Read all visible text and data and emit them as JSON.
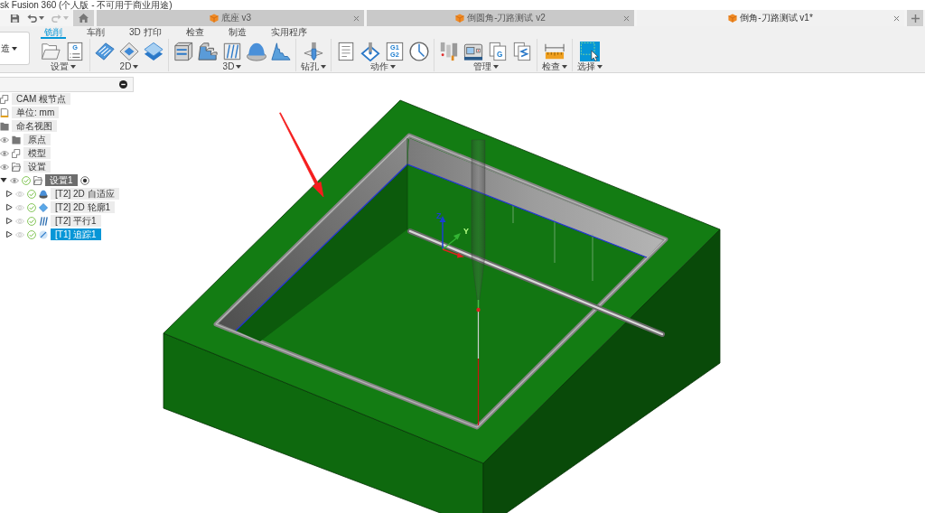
{
  "window": {
    "title": "sk Fusion 360 (个人版 - 不可用于商业用途)"
  },
  "quick_access": {
    "undo": {
      "disabled": false
    },
    "redo": {
      "disabled": true
    }
  },
  "document_tabs": [
    {
      "title": "底座 v3",
      "selected": false
    },
    {
      "title": "倒圆角-刀路测试 v2",
      "selected": false
    },
    {
      "title": "倒角-刀路测试 v1*",
      "selected": true
    }
  ],
  "workspace": {
    "label": "造"
  },
  "ribbon_tabs": [
    {
      "label": "铣削",
      "selected": true
    },
    {
      "label": "车削",
      "selected": false
    },
    {
      "label": "3D 打印",
      "selected": false
    },
    {
      "label": "检查",
      "selected": false
    },
    {
      "label": "制造",
      "selected": false
    },
    {
      "label": "实用程序",
      "selected": false
    }
  ],
  "tool_groups": [
    {
      "label": "设置",
      "tools": [
        {
          "kind": "folder",
          "active": false
        },
        {
          "kind": "nc-doc",
          "glyph": "G",
          "active": false
        }
      ]
    },
    {
      "label": "2D",
      "tools": [
        {
          "kind": "adaptive-2d",
          "active": false
        },
        {
          "kind": "pocket-2d",
          "active": false
        },
        {
          "kind": "contour-2d",
          "active": false
        }
      ]
    },
    {
      "label": "3D",
      "tools": [
        {
          "kind": "adaptive-3d",
          "active": false
        },
        {
          "kind": "steep",
          "active": false
        },
        {
          "kind": "parallel",
          "active": false
        },
        {
          "kind": "dome",
          "active": false
        },
        {
          "kind": "scallop",
          "active": false
        }
      ]
    },
    {
      "label": "钻孔",
      "tools": [
        {
          "kind": "drill",
          "active": false
        }
      ]
    },
    {
      "label": "动作",
      "tools": [
        {
          "kind": "setup-sheet",
          "active": false
        },
        {
          "kind": "probe",
          "active": false
        },
        {
          "kind": "nc-code",
          "lines": [
            "G1",
            "G2"
          ],
          "active": false
        },
        {
          "kind": "simulate",
          "active": false
        }
      ]
    },
    {
      "label": "管理",
      "tools": [
        {
          "kind": "tool-library",
          "active": false
        },
        {
          "kind": "machine",
          "active": false
        },
        {
          "kind": "post",
          "glyph": "G",
          "active": false
        },
        {
          "kind": "sheet-stack",
          "active": false
        }
      ]
    },
    {
      "label": "检查",
      "tools": [
        {
          "kind": "measure",
          "active": false
        }
      ]
    },
    {
      "label": "选择",
      "tools": [
        {
          "kind": "select",
          "active": true
        }
      ]
    }
  ],
  "browser": {
    "tree": [
      {
        "label": "CAM 根节点",
        "kind": "root",
        "selected": false,
        "children": [
          {
            "label": "单位: mm",
            "kind": "units",
            "selected": false
          },
          {
            "label": "命名视图",
            "kind": "views",
            "selected": false
          },
          {
            "label": "原点",
            "kind": "origin",
            "visible": true,
            "selected": false
          },
          {
            "label": "模型",
            "kind": "model",
            "visible": true,
            "selected": false
          },
          {
            "label": "设置",
            "kind": "setups",
            "visible": true,
            "selected": false,
            "children": [
              {
                "label": "设置1",
                "kind": "setup",
                "expanded": true,
                "visible": true,
                "valid": true,
                "active": true,
                "selected": false,
                "children": [
                  {
                    "label": "[T2] 2D 自适应",
                    "kind": "adaptive",
                    "expanded": false,
                    "visible": false,
                    "valid": true,
                    "selected": false
                  },
                  {
                    "label": "[T2] 2D 轮廓1",
                    "kind": "contour",
                    "expanded": false,
                    "visible": false,
                    "valid": true,
                    "selected": false
                  },
                  {
                    "label": "[T2] 平行1",
                    "kind": "parallel",
                    "expanded": false,
                    "visible": false,
                    "valid": true,
                    "selected": false
                  },
                  {
                    "label": "[T1] 追踪1",
                    "kind": "trace",
                    "expanded": false,
                    "visible": false,
                    "valid": true,
                    "selected": true
                  }
                ]
              }
            ]
          }
        ]
      }
    ]
  },
  "viewport": {
    "axes": [
      {
        "label": "Z"
      },
      {
        "label": "Y"
      }
    ]
  }
}
